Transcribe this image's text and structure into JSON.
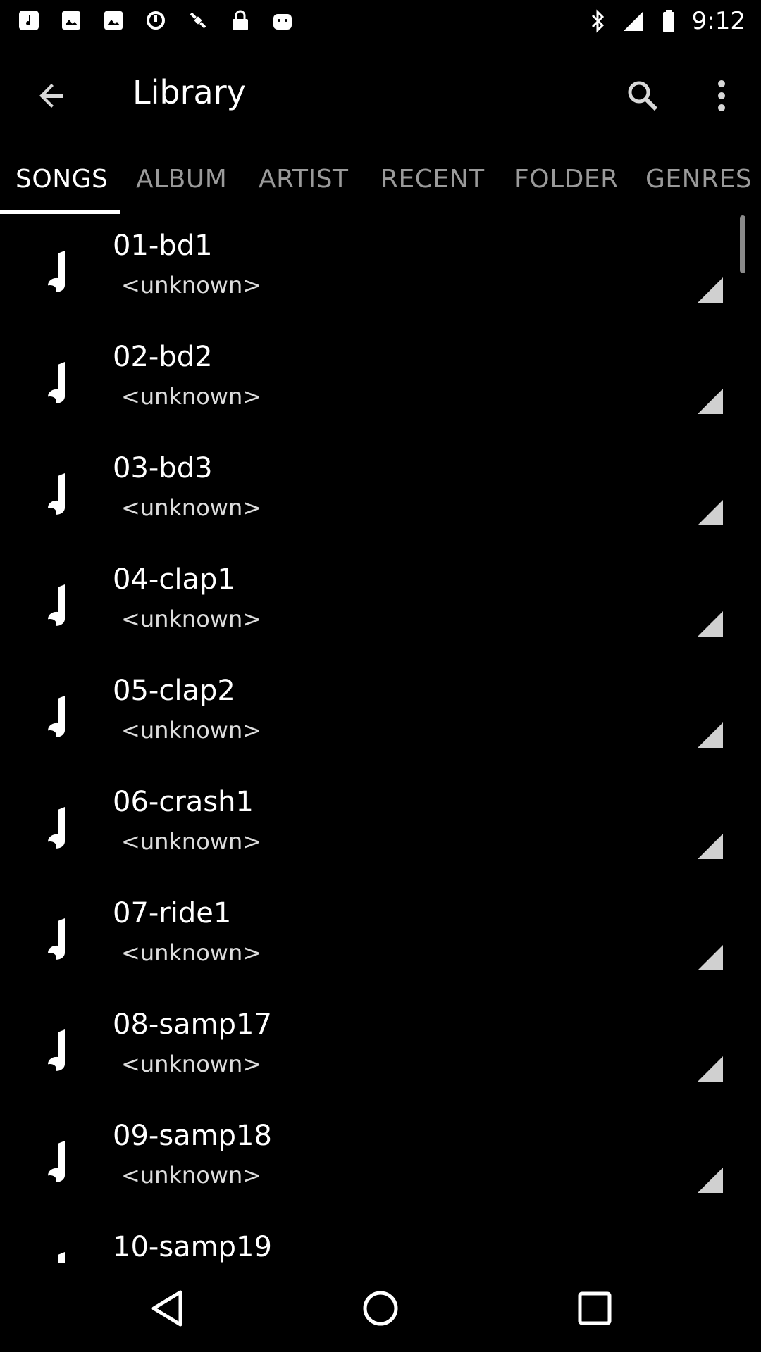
{
  "status_bar": {
    "time": "9:12",
    "left_icons": [
      "music-note-icon",
      "image-icon",
      "image-icon",
      "sync-icon",
      "satellite-icon",
      "lock-icon",
      "android-icon"
    ],
    "right_icons": [
      "bluetooth-icon",
      "signal-icon",
      "battery-icon"
    ]
  },
  "appbar": {
    "title": "Library"
  },
  "tabs": [
    {
      "label": "SONGS",
      "active": true
    },
    {
      "label": "ALBUM",
      "active": false
    },
    {
      "label": "ARTIST",
      "active": false
    },
    {
      "label": "RECENT",
      "active": false
    },
    {
      "label": "FOLDER",
      "active": false
    },
    {
      "label": "GENRES",
      "active": false
    }
  ],
  "songs": [
    {
      "title": "01-bd1",
      "artist": "<unknown>"
    },
    {
      "title": "02-bd2",
      "artist": "<unknown>"
    },
    {
      "title": "03-bd3",
      "artist": "<unknown>"
    },
    {
      "title": "04-clap1",
      "artist": "<unknown>"
    },
    {
      "title": "05-clap2",
      "artist": "<unknown>"
    },
    {
      "title": "06-crash1",
      "artist": "<unknown>"
    },
    {
      "title": "07-ride1",
      "artist": "<unknown>"
    },
    {
      "title": "08-samp17",
      "artist": "<unknown>"
    },
    {
      "title": "09-samp18",
      "artist": "<unknown>"
    },
    {
      "title": "10-samp19",
      "artist": ""
    }
  ],
  "colors": {
    "background": "#000000",
    "text": "#ffffff",
    "inactive_tab": "#9a9a9a"
  }
}
